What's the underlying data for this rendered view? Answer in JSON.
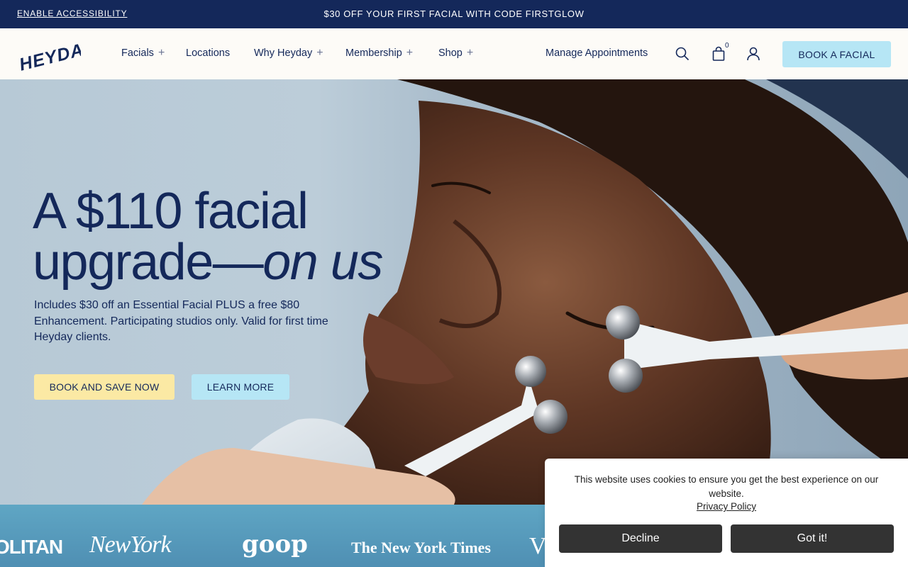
{
  "announcement": {
    "accessibility_link": "ENABLE ACCESSIBILITY",
    "promo": "$30 OFF YOUR FIRST FACIAL WITH CODE FIRSTGLOW"
  },
  "header": {
    "logo": "HEYDAY",
    "nav": [
      {
        "label": "Facials",
        "expandable": true
      },
      {
        "label": "Locations",
        "expandable": false
      },
      {
        "label": "Why Heyday",
        "expandable": true
      },
      {
        "label": "Membership",
        "expandable": true
      },
      {
        "label": "Shop",
        "expandable": true
      }
    ],
    "plus": "+",
    "manage_link": "Manage Appointments",
    "icons": [
      "search-icon",
      "shopping-bag-icon",
      "account-icon"
    ],
    "cart_count": "0",
    "book_button": "BOOK A FACIAL"
  },
  "hero": {
    "headline_line1": "A $110 facial",
    "headline_line2_plain": "upgrade—",
    "headline_line2_italic": "on us",
    "subtext": "Includes $30 off an Essential Facial PLUS a free $80 Enhancement. Participating studios only. Valid for first time Heyday clients.",
    "cta_primary": "BOOK AND SAVE NOW",
    "cta_secondary": "LEARN MORE"
  },
  "press": {
    "logos": [
      "OLITAN",
      "NewYork",
      "goop",
      "The New York Times",
      "V"
    ]
  },
  "cookie_banner": {
    "message": "This website uses cookies to ensure you get the best experience on our website.",
    "privacy_link": "Privacy Policy",
    "decline": "Decline",
    "accept": "Got it!"
  },
  "colors": {
    "navy": "#14285a",
    "header_bg": "#fdfbf7",
    "light_blue": "#b6e6f5",
    "yellow": "#fbe9a4",
    "cookie_button": "#333333"
  }
}
